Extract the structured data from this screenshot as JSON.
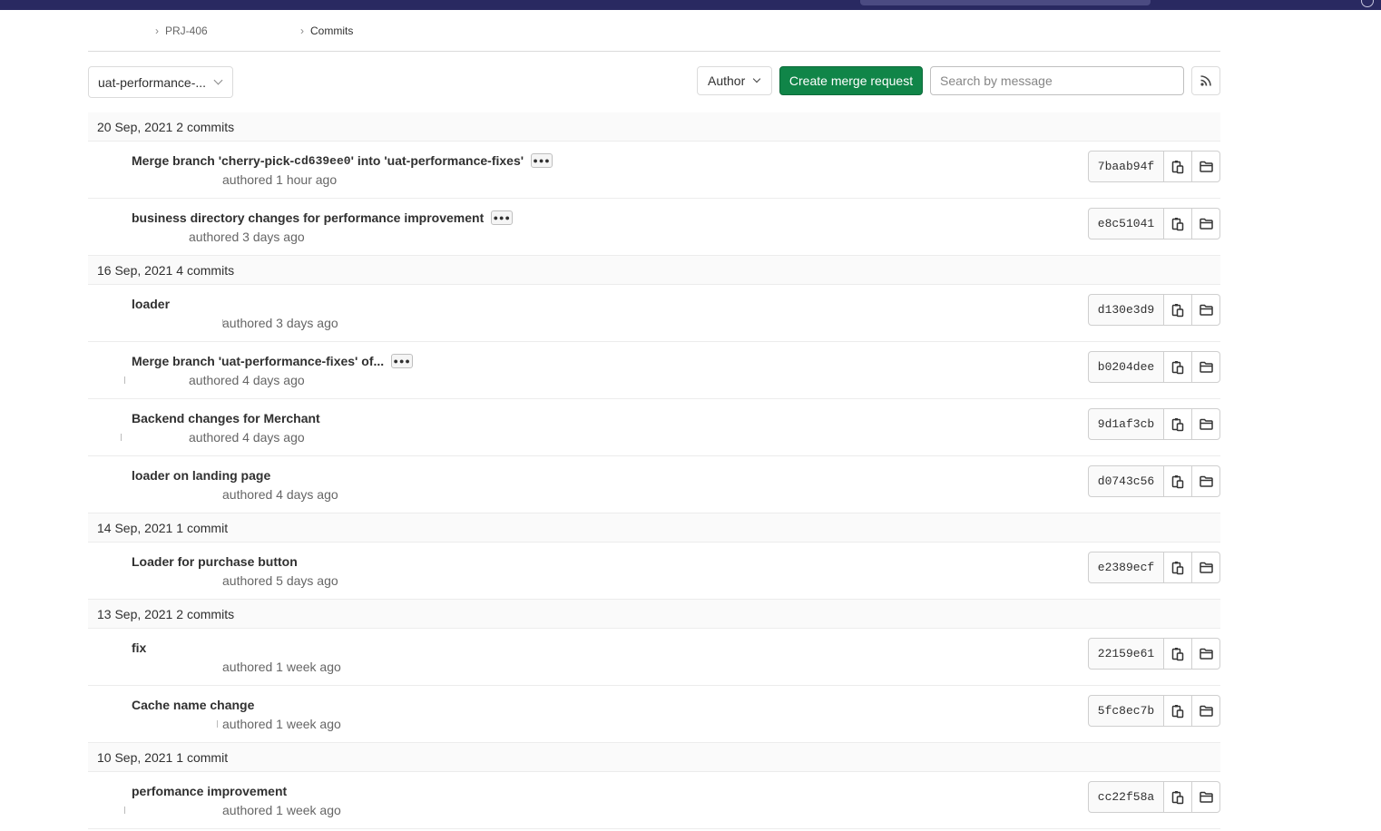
{
  "breadcrumb": {
    "items": [
      {
        "label": "PRJ-406"
      },
      {
        "label": "Commits"
      }
    ]
  },
  "toolbar": {
    "branch": "uat-performance-...",
    "author_label": "Author",
    "create_mr_label": "Create merge request",
    "search_placeholder": "Search by message"
  },
  "groups": [
    {
      "date": "20 Sep, 2021",
      "count": "2 commits",
      "commits": [
        {
          "title_parts": [
            "Merge branch 'cherry-pick-",
            "cd639ee0",
            "' into 'uat-performance-fixes'"
          ],
          "expandable": true,
          "meta": "authored 1 hour ago",
          "sha": "7baab94f"
        },
        {
          "title": "business directory changes for performance improvement",
          "expandable": true,
          "meta": "authored 3 days ago",
          "sha": "e8c51041"
        }
      ]
    },
    {
      "date": "16 Sep, 2021",
      "count": "4 commits",
      "commits": [
        {
          "title": "loader",
          "expandable": false,
          "meta": "authored 3 days ago",
          "sha": "d130e3d9"
        },
        {
          "title": "Merge branch 'uat-performance-fixes' of...",
          "expandable": true,
          "meta": "authored 4 days ago",
          "sha": "b0204dee"
        },
        {
          "title": "Backend changes for Merchant",
          "expandable": false,
          "meta": "authored 4 days ago",
          "sha": "9d1af3cb"
        },
        {
          "title": "loader on landing page",
          "expandable": false,
          "meta": "authored 4 days ago",
          "sha": "d0743c56"
        }
      ]
    },
    {
      "date": "14 Sep, 2021",
      "count": "1 commit",
      "commits": [
        {
          "title": "Loader for purchase button",
          "expandable": false,
          "meta": "authored 5 days ago",
          "sha": "e2389ecf"
        }
      ]
    },
    {
      "date": "13 Sep, 2021",
      "count": "2 commits",
      "commits": [
        {
          "title": "fix",
          "expandable": false,
          "meta": "authored 1 week ago",
          "sha": "22159e61"
        },
        {
          "title": "Cache name change",
          "expandable": false,
          "meta": "authored 1 week ago",
          "sha": "5fc8ec7b"
        }
      ]
    },
    {
      "date": "10 Sep, 2021",
      "count": "1 commit",
      "commits": [
        {
          "title": "perfomance improvement",
          "expandable": false,
          "meta": "authored 1 week ago",
          "sha": "cc22f58a"
        }
      ]
    }
  ],
  "colors": {
    "topbar": "#292961",
    "primary_button": "#108548"
  }
}
